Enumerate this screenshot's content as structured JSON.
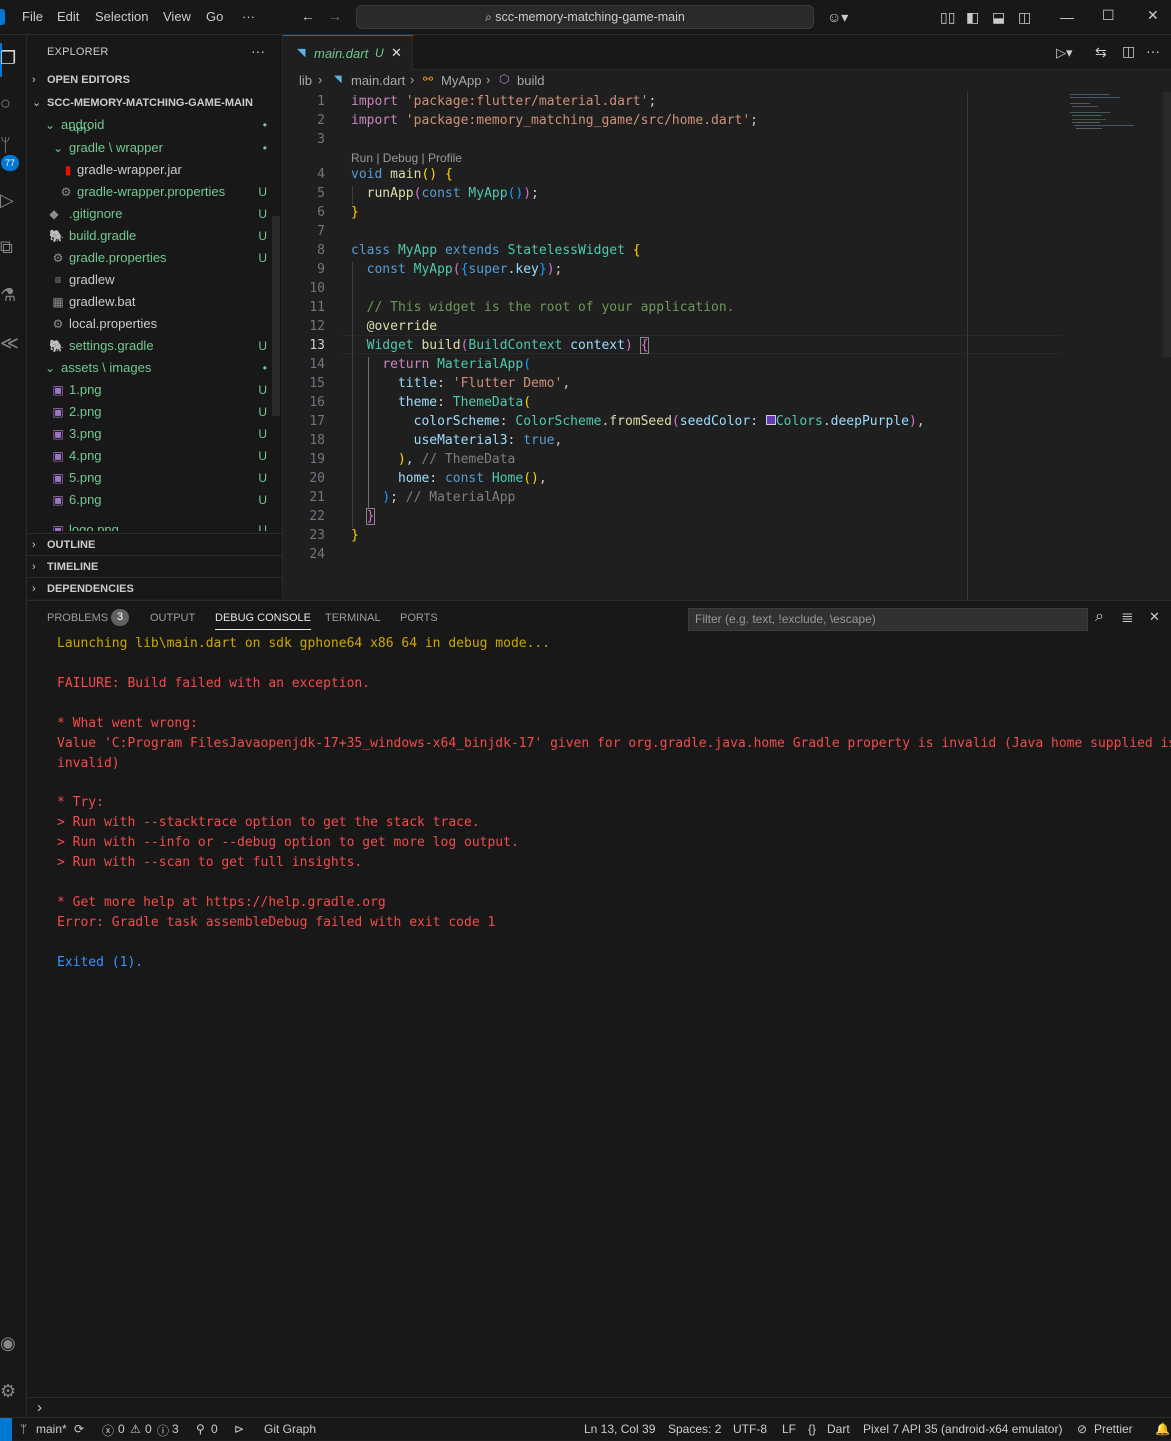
{
  "menu": [
    "File",
    "Edit",
    "Selection",
    "View",
    "Go",
    "···"
  ],
  "command_center": "scc-memory-matching-game-main",
  "explorer": {
    "title": "EXPLORER",
    "open_editors": "OPEN EDITORS",
    "root": "SCC-MEMORY-MATCHING-GAME-MAIN",
    "outline": "OUTLINE",
    "timeline": "TIMELINE",
    "dependencies": "DEPENDENCIES",
    "rows": [
      {
        "label": "android",
        "status": "•",
        "icon": "chevron-down"
      },
      {
        "label": "app",
        "status": "•",
        "icon": "chevron-right"
      },
      {
        "label": "gradle \\ wrapper",
        "status": "•",
        "icon": "chevron-down"
      },
      {
        "label": "gradle-wrapper.jar",
        "status": "",
        "icon": "jar"
      },
      {
        "label": "gradle-wrapper.properties",
        "status": "U",
        "icon": "gear"
      },
      {
        "label": ".gitignore",
        "status": "U",
        "icon": "git"
      },
      {
        "label": "build.gradle",
        "status": "U",
        "icon": "gradle"
      },
      {
        "label": "gradle.properties",
        "status": "U",
        "icon": "gear"
      },
      {
        "label": "gradlew",
        "status": "",
        "icon": "lines"
      },
      {
        "label": "gradlew.bat",
        "status": "",
        "icon": "bat"
      },
      {
        "label": "local.properties",
        "status": "",
        "icon": "gear"
      },
      {
        "label": "settings.gradle",
        "status": "U",
        "icon": "gradle"
      },
      {
        "label": "assets \\ images",
        "status": "•",
        "icon": "chevron-down"
      },
      {
        "label": "1.png",
        "status": "U",
        "icon": "image"
      },
      {
        "label": "2.png",
        "status": "U",
        "icon": "image"
      },
      {
        "label": "3.png",
        "status": "U",
        "icon": "image"
      },
      {
        "label": "4.png",
        "status": "U",
        "icon": "image"
      },
      {
        "label": "5.png",
        "status": "U",
        "icon": "image"
      },
      {
        "label": "6.png",
        "status": "U",
        "icon": "image"
      },
      {
        "label": "logo.png",
        "status": "U",
        "icon": "image"
      }
    ]
  },
  "editor": {
    "tab_label": "main.dart",
    "tab_status": "U",
    "breadcrumb": [
      "lib",
      "main.dart",
      "MyApp",
      "build"
    ],
    "code_lens": "Run | Debug | Profile",
    "active_line": 13
  },
  "panel": {
    "tabs": [
      "PROBLEMS",
      "OUTPUT",
      "DEBUG CONSOLE",
      "TERMINAL",
      "PORTS"
    ],
    "problems_count": "3",
    "filter_placeholder": "Filter (e.g. text, !exclude, \\escape)",
    "console": [
      {
        "text": "Launching lib\\main.dart on sdk gphone64 x86 64 in debug mode...",
        "color": "#cca700"
      },
      {
        "text": "FAILURE: Build failed with an exception.",
        "color": "#f14c4c"
      },
      {
        "text": "* What went wrong:",
        "color": "#f14c4c"
      },
      {
        "text": "Value 'C:Program FilesJavaopenjdk-17+35_windows-x64_binjdk-17' given for org.gradle.java.home Gradle property is invalid (Java home supplied is",
        "color": "#f14c4c"
      },
      {
        "text": "invalid)",
        "color": "#f14c4c"
      },
      {
        "text": "* Try:",
        "color": "#f14c4c"
      },
      {
        "text": "> Run with --stacktrace option to get the stack trace.",
        "color": "#f14c4c"
      },
      {
        "text": "> Run with --info or --debug option to get more log output.",
        "color": "#f14c4c"
      },
      {
        "text": "> Run with --scan to get full insights.",
        "color": "#f14c4c"
      },
      {
        "text": "* Get more help at https://help.gradle.org",
        "color": "#f14c4c"
      },
      {
        "text": "Error: Gradle task assembleDebug failed with exit code 1",
        "color": "#f14c4c"
      },
      {
        "text": "Exited (1).",
        "color": "#3794ff"
      }
    ]
  },
  "status_bar": {
    "branch": "main*",
    "errors": "0",
    "warnings": "0",
    "info": "3",
    "ports": "0",
    "git_graph": "Git Graph",
    "cursor": "Ln 13, Col 39",
    "spaces": "Spaces: 2",
    "encoding": "UTF-8",
    "eol": "LF",
    "language": "Dart",
    "device": "Pixel 7 API 35 (android-x64 emulator)",
    "formatter": "Prettier"
  },
  "activity_badge": "77",
  "colors": {
    "accent": "#0078d4",
    "untracked": "#73c991",
    "error": "#f14c4c",
    "warning": "#cca700",
    "info": "#3794ff"
  }
}
